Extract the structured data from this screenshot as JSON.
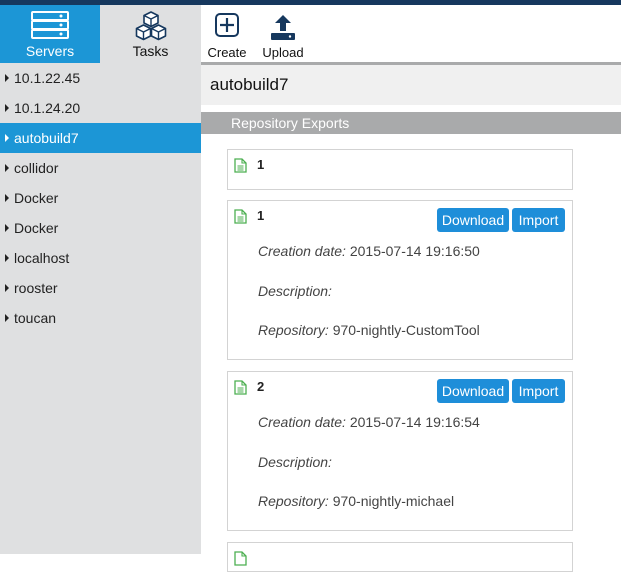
{
  "nav": {
    "servers_label": "Servers",
    "tasks_label": "Tasks"
  },
  "toolbar": {
    "create_label": "Create",
    "upload_label": "Upload"
  },
  "sidebar": {
    "items": [
      {
        "label": "10.1.22.45"
      },
      {
        "label": "10.1.24.20"
      },
      {
        "label": "autobuild7"
      },
      {
        "label": "collidor"
      },
      {
        "label": "Docker"
      },
      {
        "label": "Docker"
      },
      {
        "label": "localhost"
      },
      {
        "label": "rooster"
      },
      {
        "label": "toucan"
      }
    ],
    "active_index": 2
  },
  "main": {
    "title": "autobuild7",
    "section": "Repository Exports",
    "exports": [
      {
        "name": "1"
      },
      {
        "name": "1",
        "download_label": "Download",
        "import_label": "Import",
        "creation_label": "Creation date:",
        "creation_value": "2015-07-14 19:16:50",
        "description_label": "Description:",
        "description_value": "",
        "repository_label": "Repository:",
        "repository_value": "970-nightly-CustomTool"
      },
      {
        "name": "2",
        "download_label": "Download",
        "import_label": "Import",
        "creation_label": "Creation date:",
        "creation_value": "2015-07-14 19:16:54",
        "description_label": "Description:",
        "description_value": "",
        "repository_label": "Repository:",
        "repository_value": "970-nightly-michael"
      }
    ]
  },
  "colors": {
    "accent": "#1c96d6",
    "topbar": "#16385e",
    "sidebar_bg": "#dfe0e1",
    "section_bar": "#a9aaab",
    "button": "#1e8ed9",
    "doc_icon": "#4caf50"
  },
  "icons": {
    "servers": "server-stack-icon",
    "tasks": "cubes-icon",
    "create": "plus-square-icon",
    "upload": "upload-icon",
    "export": "document-icon"
  }
}
